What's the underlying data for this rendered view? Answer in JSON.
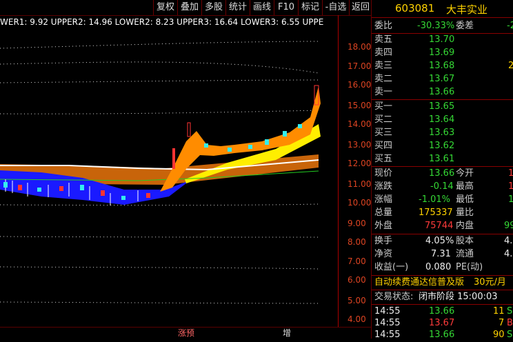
{
  "toolbar": {
    "buttons": [
      "复权",
      "叠加",
      "多股",
      "统计",
      "画线",
      "F10",
      "标记",
      "-自选",
      "返回"
    ]
  },
  "indicator_header": "WER1: 9.92  UPPER2: 14.96  LOWER2: 8.23  UPPER3: 16.64  LOWER3: 6.55  UPPER",
  "price_axis": [
    "18.00",
    "17.00",
    "16.00",
    "15.00",
    "14.00",
    "13.00",
    "12.00",
    "11.00",
    "10.00",
    "9.00",
    "8.00",
    "7.00",
    "6.00",
    "5.00",
    "4.00"
  ],
  "bottom_labels": {
    "label1": "涨预",
    "label2": "增"
  },
  "stock": {
    "code": "603081",
    "name": "大丰实业"
  },
  "weibi": {
    "label": "委比",
    "value": "-30.33%",
    "label2": "委差",
    "value2": "-2"
  },
  "asks": [
    {
      "label": "卖五",
      "price": "13.70",
      "vol": ""
    },
    {
      "label": "卖四",
      "price": "13.69",
      "vol": ""
    },
    {
      "label": "卖三",
      "price": "13.68",
      "vol": "2"
    },
    {
      "label": "卖二",
      "price": "13.67",
      "vol": ""
    },
    {
      "label": "卖一",
      "price": "13.66",
      "vol": ""
    }
  ],
  "bids": [
    {
      "label": "买一",
      "price": "13.65",
      "vol": ""
    },
    {
      "label": "买二",
      "price": "13.64",
      "vol": ""
    },
    {
      "label": "买三",
      "price": "13.63",
      "vol": ""
    },
    {
      "label": "买四",
      "price": "13.62",
      "vol": ""
    },
    {
      "label": "买五",
      "price": "13.61",
      "vol": ""
    }
  ],
  "stats": [
    {
      "l1": "现价",
      "v1": "13.66",
      "l2": "今开",
      "v2": "1"
    },
    {
      "l1": "涨跌",
      "v1": "-0.14",
      "l2": "最高",
      "v2": "1"
    },
    {
      "l1": "涨幅",
      "v1": "-1.01%",
      "l2": "最低",
      "v2": "1"
    },
    {
      "l1": "总量",
      "v1": "175337",
      "l2": "量比",
      "v2": ""
    },
    {
      "l1": "外盘",
      "v1": "75744",
      "l2": "内盘",
      "v2": "99"
    }
  ],
  "stats2": [
    {
      "l1": "换手",
      "v1": "4.05%",
      "l2": "股本",
      "v2": "4."
    },
    {
      "l1": "净资",
      "v1": "7.31",
      "l2": "流通",
      "v2": "4."
    },
    {
      "l1": "收益(一)",
      "v1": "0.080",
      "l2": "PE(动)",
      "v2": ""
    }
  ],
  "promo": {
    "text": "自动续费通达信普及版",
    "price": "30元/月"
  },
  "trade_status": {
    "label": "交易状态:",
    "value": "闭市阶段 15:00:03"
  },
  "ticks": [
    {
      "time": "14:55",
      "price": "13.66",
      "vol": "11",
      "side": "S"
    },
    {
      "time": "14:55",
      "price": "13.67",
      "vol": "7",
      "side": "B"
    },
    {
      "time": "14:55",
      "price": "13.66",
      "vol": "90",
      "side": "S"
    }
  ],
  "colors": {
    "up": "#ff3b3b",
    "down": "#35d835",
    "accent": "#ffd200"
  }
}
